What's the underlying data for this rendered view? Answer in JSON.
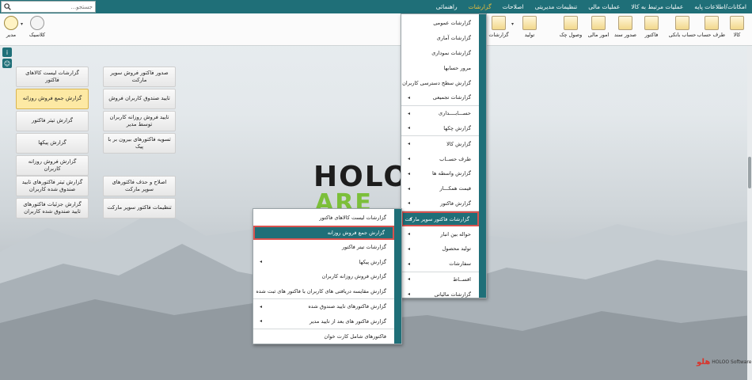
{
  "menubar": {
    "items": [
      "امکانات/اطلاعات پایه",
      "عملیات مرتبط به کالا",
      "عملیات مالی",
      "تنظیمات مدیریتی",
      "اصلاحات",
      "گزارشات",
      "راهنمائی"
    ],
    "active": "گزارشات",
    "search_placeholder": "جستجو..."
  },
  "toolbar": {
    "buttons": [
      "کالا",
      "طرف حساب",
      "حساب بانکی",
      "فاکتور",
      "صدور سند",
      "امور مالی",
      "وصول چک",
      "تولید",
      "گزارشات"
    ],
    "left_buttons": [
      "کلاسیک",
      "مدیر"
    ]
  },
  "report_buttons": {
    "col_right": [
      "صدور فاکتور فروش سوپر مارکت",
      "تایید صندوق کاربران فروش",
      "تایید فروش روزانه کاربران توسط مدیر",
      "تسویه فاکتورهای بیرون بر با پیک",
      "اصلاح و حذف فاکتورهای سوپر مارکت",
      "تنظیمات فاکتور سوپر مارکت"
    ],
    "col_left": [
      "گزارشات لیست کالاهای فاکتور",
      "گزارش جمع فروش روزانه",
      "گزارش تیتر فاکتور",
      "گزارش پیکها",
      "گزارش فروش روزانه کاربران",
      "گزارش تیتر فاکتورهای تایید صندوق شده کاربران",
      "گزارش جزئیات فاکتورهای تایید صندوق شده کاربران"
    ]
  },
  "logo": {
    "line1": "HOLO",
    "line2": "ARE"
  },
  "reports_menu": [
    {
      "label": "گزارشات عمومی",
      "arrow": false
    },
    {
      "label": "گزارشات آماری",
      "arrow": false
    },
    {
      "label": "گزارشات نموداری",
      "arrow": false
    },
    {
      "label": "مرور حسابها",
      "arrow": false
    },
    {
      "label": "گزارش سطح دسترسی کاربران",
      "arrow": false
    },
    {
      "label": "گزارشات تجمیعی",
      "arrow": true
    },
    {
      "label": "حســـابــــداری",
      "arrow": true
    },
    {
      "label": "گزارش چکها",
      "arrow": true
    },
    {
      "label": "گزارش کالا",
      "arrow": true
    },
    {
      "label": "طرف حســاب",
      "arrow": true
    },
    {
      "label": "گزارش واسطه ها",
      "arrow": true
    },
    {
      "label": "قیمت همکـــار",
      "arrow": true
    },
    {
      "label": "گزارش فاکتور",
      "arrow": true
    },
    {
      "label": "گزارشات فاکتور سوپر مارکت",
      "arrow": true
    },
    {
      "label": "حواله بین انبار",
      "arrow": true
    },
    {
      "label": "تولید محصول",
      "arrow": true
    },
    {
      "label": "سفارشات",
      "arrow": true
    },
    {
      "label": "اقســاط",
      "arrow": true
    },
    {
      "label": "گزارشات مالیاتی",
      "arrow": true
    }
  ],
  "supermarket_menu": [
    {
      "label": "گزارشات لیست کالاهای فاکتور",
      "arrow": false
    },
    {
      "label": "گزارش جمع فروش روزانه",
      "arrow": false
    },
    {
      "label": "گزارشات تیتر فاکتور",
      "arrow": false
    },
    {
      "label": "گزارش پیکها",
      "arrow": true
    },
    {
      "label": "گزارش فروش روزانه کاربران",
      "arrow": false
    },
    {
      "label": "گزارش مقایسه دریافتی های  کاربران با فاکتور های ثبت شده",
      "arrow": false
    },
    {
      "label": "گزارش فاکتورهای تایید صندوق شده",
      "arrow": true
    },
    {
      "label": "گزارش فاکتور های بعد از تایید مدیر",
      "arrow": true
    },
    {
      "label": "فاکتورهای شامل کارت خوان",
      "arrow": false
    }
  ],
  "brand": {
    "name": "هلو",
    "sub": "HOLOO Software"
  },
  "colors": {
    "menubar": "#1f6f78",
    "active_menu": "#f2c23a",
    "highlight_border": "#d9534f",
    "selected_button": "#fde9a4"
  }
}
